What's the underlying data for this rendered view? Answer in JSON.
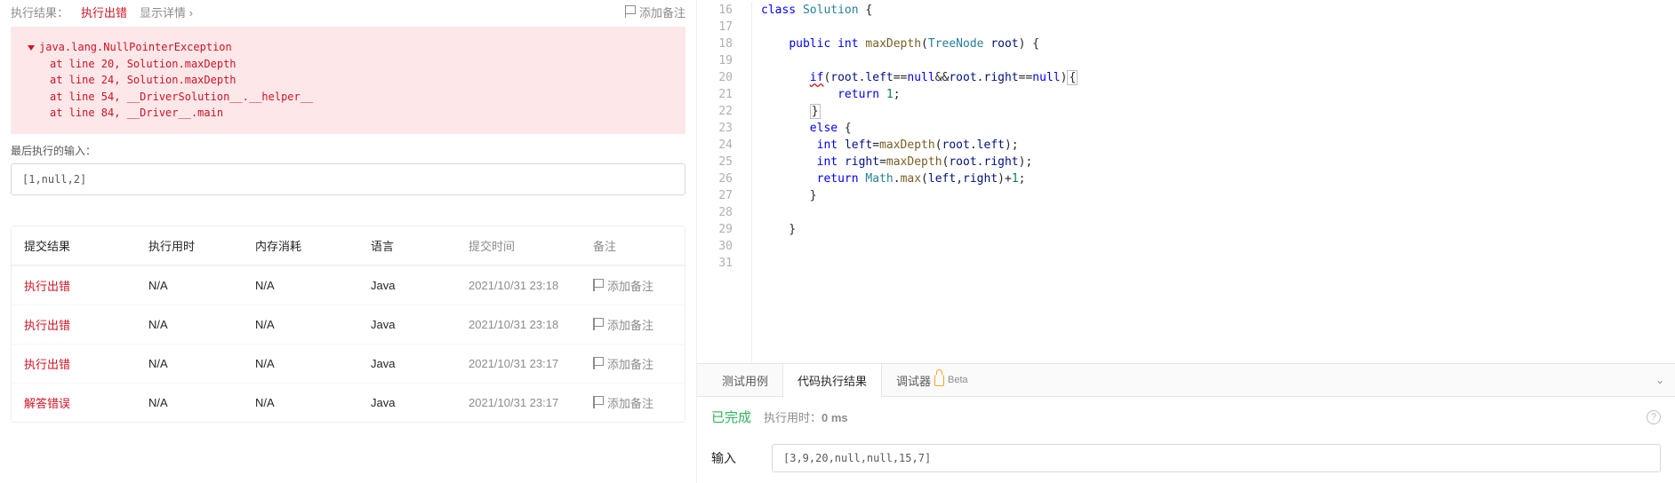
{
  "resultHeader": {
    "label": "执行结果：",
    "status": "执行出错",
    "detailLink": "显示详情 ›",
    "addNote": "添加备注"
  },
  "errorBox": {
    "title": "java.lang.NullPointerException",
    "trace": [
      "at line 20, Solution.maxDepth",
      "at line 24, Solution.maxDepth",
      "at line 54, __DriverSolution__.__helper__",
      "at line 84, __Driver__.main"
    ]
  },
  "lastInput": {
    "label": "最后执行的输入：",
    "value": "[1,null,2]"
  },
  "table": {
    "headers": {
      "result": "提交结果",
      "time": "执行用时",
      "mem": "内存消耗",
      "lang": "语言",
      "submit": "提交时间",
      "notes": "备注"
    },
    "rows": [
      {
        "result": "执行出错",
        "time": "N/A",
        "mem": "N/A",
        "lang": "Java",
        "submit": "2021/10/31 23:18",
        "note": "添加备注"
      },
      {
        "result": "执行出错",
        "time": "N/A",
        "mem": "N/A",
        "lang": "Java",
        "submit": "2021/10/31 23:18",
        "note": "添加备注"
      },
      {
        "result": "执行出错",
        "time": "N/A",
        "mem": "N/A",
        "lang": "Java",
        "submit": "2021/10/31 23:17",
        "note": "添加备注"
      },
      {
        "result": "解答错误",
        "time": "N/A",
        "mem": "N/A",
        "lang": "Java",
        "submit": "2021/10/31 23:17",
        "note": "添加备注"
      }
    ]
  },
  "code": {
    "startLine": 16,
    "lines": [
      [
        {
          "t": "kw",
          "s": "class"
        },
        {
          "t": "",
          "s": " "
        },
        {
          "t": "cls",
          "s": "Solution"
        },
        {
          "t": "",
          "s": " {"
        }
      ],
      [],
      [
        {
          "t": "",
          "s": "    "
        },
        {
          "t": "kw",
          "s": "public"
        },
        {
          "t": "",
          "s": " "
        },
        {
          "t": "kw",
          "s": "int"
        },
        {
          "t": "",
          "s": " "
        },
        {
          "t": "mname",
          "s": "maxDepth"
        },
        {
          "t": "",
          "s": "("
        },
        {
          "t": "cls",
          "s": "TreeNode"
        },
        {
          "t": "",
          "s": " "
        },
        {
          "t": "ident",
          "s": "root"
        },
        {
          "t": "",
          "s": ") {"
        }
      ],
      [],
      [
        {
          "t": "",
          "s": "       "
        },
        {
          "t": "err kw",
          "s": "if"
        },
        {
          "t": "",
          "s": "("
        },
        {
          "t": "ident",
          "s": "root"
        },
        {
          "t": "",
          "s": "."
        },
        {
          "t": "ident",
          "s": "left"
        },
        {
          "t": "",
          "s": "=="
        },
        {
          "t": "kw",
          "s": "null"
        },
        {
          "t": "",
          "s": "&&"
        },
        {
          "t": "ident",
          "s": "root"
        },
        {
          "t": "",
          "s": "."
        },
        {
          "t": "ident",
          "s": "right"
        },
        {
          "t": "",
          "s": "=="
        },
        {
          "t": "kw",
          "s": "null"
        },
        {
          "t": "",
          "s": ")"
        },
        {
          "t": "brace",
          "s": "{"
        }
      ],
      [
        {
          "t": "",
          "s": "           "
        },
        {
          "t": "kw",
          "s": "return"
        },
        {
          "t": "",
          "s": " "
        },
        {
          "t": "num",
          "s": "1"
        },
        {
          "t": "",
          "s": ";"
        }
      ],
      [
        {
          "t": "",
          "s": "       "
        },
        {
          "t": "brace",
          "s": "}"
        }
      ],
      [
        {
          "t": "",
          "s": "       "
        },
        {
          "t": "kw",
          "s": "else"
        },
        {
          "t": "",
          "s": " {"
        }
      ],
      [
        {
          "t": "",
          "s": "        "
        },
        {
          "t": "kw",
          "s": "int"
        },
        {
          "t": "",
          "s": " "
        },
        {
          "t": "ident",
          "s": "left"
        },
        {
          "t": "",
          "s": "="
        },
        {
          "t": "mname",
          "s": "maxDepth"
        },
        {
          "t": "",
          "s": "("
        },
        {
          "t": "ident",
          "s": "root"
        },
        {
          "t": "",
          "s": "."
        },
        {
          "t": "ident",
          "s": "left"
        },
        {
          "t": "",
          "s": ");"
        }
      ],
      [
        {
          "t": "",
          "s": "        "
        },
        {
          "t": "kw",
          "s": "int"
        },
        {
          "t": "",
          "s": " "
        },
        {
          "t": "ident",
          "s": "right"
        },
        {
          "t": "",
          "s": "="
        },
        {
          "t": "mname",
          "s": "maxDepth"
        },
        {
          "t": "",
          "s": "("
        },
        {
          "t": "ident",
          "s": "root"
        },
        {
          "t": "",
          "s": "."
        },
        {
          "t": "ident",
          "s": "right"
        },
        {
          "t": "",
          "s": ");"
        }
      ],
      [
        {
          "t": "",
          "s": "        "
        },
        {
          "t": "kw",
          "s": "return"
        },
        {
          "t": "",
          "s": " "
        },
        {
          "t": "cls",
          "s": "Math"
        },
        {
          "t": "",
          "s": "."
        },
        {
          "t": "mname",
          "s": "max"
        },
        {
          "t": "",
          "s": "("
        },
        {
          "t": "ident",
          "s": "left"
        },
        {
          "t": "",
          "s": ","
        },
        {
          "t": "ident",
          "s": "right"
        },
        {
          "t": "",
          "s": ")+"
        },
        {
          "t": "num",
          "s": "1"
        },
        {
          "t": "",
          "s": ";"
        }
      ],
      [
        {
          "t": "",
          "s": "       }"
        }
      ],
      [],
      [
        {
          "t": "",
          "s": "    }"
        }
      ],
      [],
      []
    ]
  },
  "bottomTabs": {
    "test": "测试用例",
    "result": "代码执行结果",
    "debugger": "调试器",
    "beta": "Beta"
  },
  "bottomResult": {
    "done": "已完成",
    "runtimeLabel": "执行用时：",
    "runtimeBold": "0 ms",
    "inputLabel": "输入",
    "inputValue": "[3,9,20,null,null,15,7]"
  }
}
